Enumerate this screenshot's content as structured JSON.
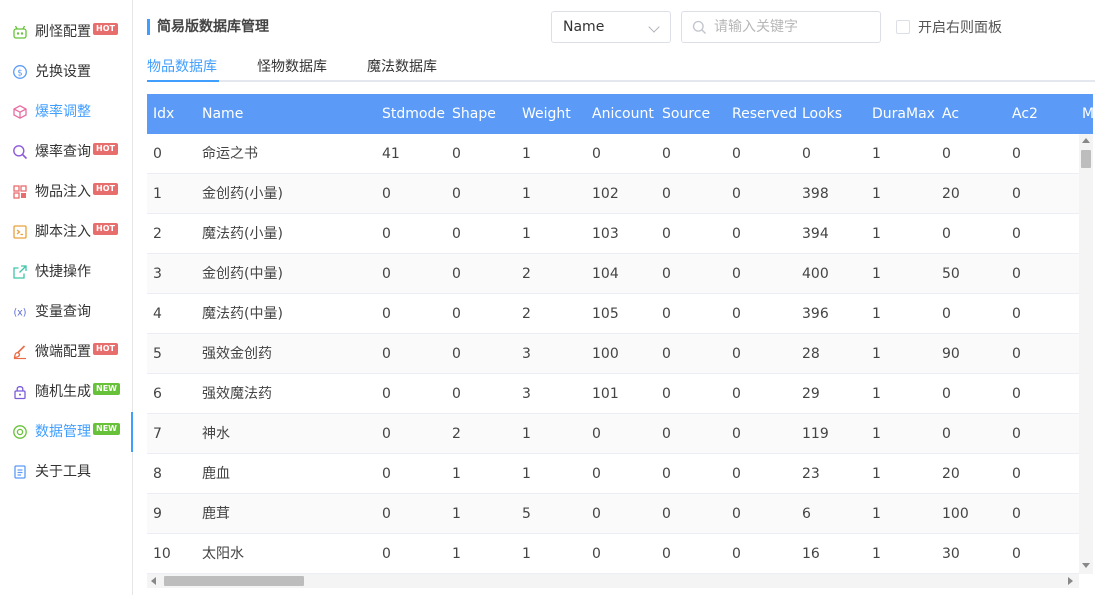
{
  "sidebar": {
    "items": [
      {
        "label": "刷怪配置",
        "icon": "robot-icon",
        "badge": "HOT"
      },
      {
        "label": "兑换设置",
        "icon": "coin-icon",
        "badge": ""
      },
      {
        "label": "爆率调整",
        "icon": "cube-icon",
        "badge": ""
      },
      {
        "label": "爆率查询",
        "icon": "search-icon",
        "badge": "HOT"
      },
      {
        "label": "物品注入",
        "icon": "grid-icon",
        "badge": "HOT"
      },
      {
        "label": "脚本注入",
        "icon": "script-icon",
        "badge": "HOT"
      },
      {
        "label": "快捷操作",
        "icon": "share-icon",
        "badge": ""
      },
      {
        "label": "变量查询",
        "icon": "variable-icon",
        "badge": ""
      },
      {
        "label": "微端配置",
        "icon": "brush-icon",
        "badge": "HOT"
      },
      {
        "label": "随机生成",
        "icon": "lock-icon",
        "badge": "NEW"
      },
      {
        "label": "数据管理",
        "icon": "settings-icon",
        "badge": "NEW"
      },
      {
        "label": "关于工具",
        "icon": "document-icon",
        "badge": ""
      }
    ]
  },
  "header": {
    "title": "简易版数据库管理",
    "select_value": "Name",
    "search_placeholder": "请输入关键字",
    "right_panel_label": "开启右则面板"
  },
  "tabs": [
    "物品数据库",
    "怪物数据库",
    "魔法数据库"
  ],
  "table": {
    "columns": [
      "Idx",
      "Name",
      "Stdmode",
      "Shape",
      "Weight",
      "Anicount",
      "Source",
      "Reserved",
      "Looks",
      "DuraMax",
      "Ac",
      "Ac2",
      "Ma"
    ],
    "rows": [
      [
        "0",
        "命运之书",
        "41",
        "0",
        "1",
        "0",
        "0",
        "0",
        "0",
        "1",
        "0",
        "0"
      ],
      [
        "1",
        "金创药(小量)",
        "0",
        "0",
        "1",
        "102",
        "0",
        "0",
        "398",
        "1",
        "20",
        "0"
      ],
      [
        "2",
        "魔法药(小量)",
        "0",
        "0",
        "1",
        "103",
        "0",
        "0",
        "394",
        "1",
        "0",
        "0"
      ],
      [
        "3",
        "金创药(中量)",
        "0",
        "0",
        "2",
        "104",
        "0",
        "0",
        "400",
        "1",
        "50",
        "0"
      ],
      [
        "4",
        "魔法药(中量)",
        "0",
        "0",
        "2",
        "105",
        "0",
        "0",
        "396",
        "1",
        "0",
        "0"
      ],
      [
        "5",
        "强效金创药",
        "0",
        "0",
        "3",
        "100",
        "0",
        "0",
        "28",
        "1",
        "90",
        "0"
      ],
      [
        "6",
        "强效魔法药",
        "0",
        "0",
        "3",
        "101",
        "0",
        "0",
        "29",
        "1",
        "0",
        "0"
      ],
      [
        "7",
        "神水",
        "0",
        "2",
        "1",
        "0",
        "0",
        "0",
        "119",
        "1",
        "0",
        "0"
      ],
      [
        "8",
        "鹿血",
        "0",
        "1",
        "1",
        "0",
        "0",
        "0",
        "23",
        "1",
        "20",
        "0"
      ],
      [
        "9",
        "鹿茸",
        "0",
        "1",
        "5",
        "0",
        "0",
        "0",
        "6",
        "1",
        "100",
        "0"
      ],
      [
        "10",
        "太阳水",
        "0",
        "1",
        "1",
        "0",
        "0",
        "0",
        "16",
        "1",
        "30",
        "0"
      ]
    ]
  },
  "colors": {
    "accent": "#409eff",
    "header_bg": "#5b9bf7",
    "hot": "#e86d6d",
    "new": "#67c23a"
  }
}
